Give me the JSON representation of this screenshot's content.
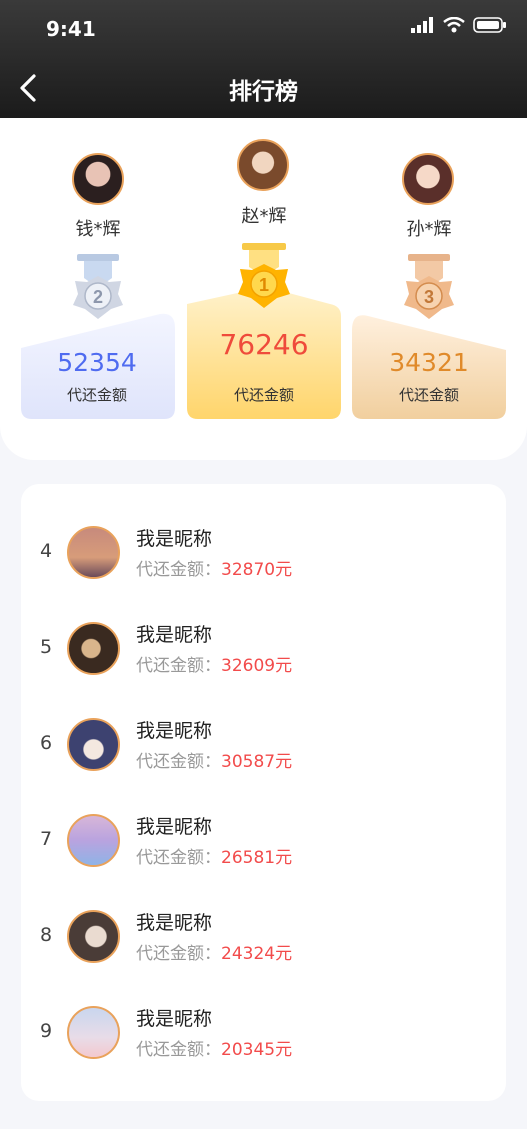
{
  "status": {
    "time": "9:41"
  },
  "header": {
    "title": "排行榜"
  },
  "top": [
    {
      "rank": "2",
      "name": "钱*辉",
      "amount": "52354",
      "label": "代还金额",
      "color": "#4f6bf0"
    },
    {
      "rank": "1",
      "name": "赵*辉",
      "amount": "76246",
      "label": "代还金额",
      "color": "#ef4b3b"
    },
    {
      "rank": "3",
      "name": "孙*辉",
      "amount": "34321",
      "label": "代还金额",
      "color": "#e08a2a"
    }
  ],
  "list": {
    "label": "代还金额：",
    "items": [
      {
        "rank": "4",
        "name": "我是昵称",
        "amount": "32870元"
      },
      {
        "rank": "5",
        "name": "我是昵称",
        "amount": "32609元"
      },
      {
        "rank": "6",
        "name": "我是昵称",
        "amount": "30587元"
      },
      {
        "rank": "7",
        "name": "我是昵称",
        "amount": "26581元"
      },
      {
        "rank": "8",
        "name": "我是昵称",
        "amount": "24324元"
      },
      {
        "rank": "9",
        "name": "我是昵称",
        "amount": "20345元"
      }
    ]
  }
}
